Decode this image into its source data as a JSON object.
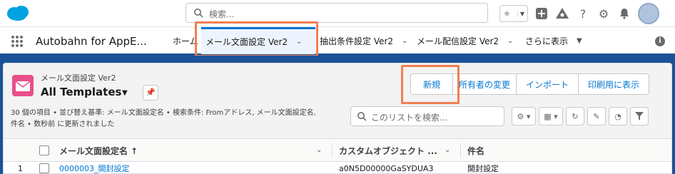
{
  "header": {
    "search_placeholder": "検索...",
    "icons": [
      "cloud-logo",
      "favorites-star-icon",
      "add-icon",
      "trailhead-icon",
      "help-icon",
      "setup-gear-icon",
      "notifications-bell-icon",
      "user-avatar"
    ]
  },
  "nav": {
    "app_name": "Autobahn for AppE...",
    "items": [
      {
        "label": "ホーム",
        "dropdown": false,
        "active": false
      },
      {
        "label": "メール文面設定 Ver2",
        "dropdown": true,
        "active": true
      },
      {
        "label": "抽出条件設定 Ver2",
        "dropdown": true,
        "active": false
      },
      {
        "label": "メール配信設定 Ver2",
        "dropdown": true,
        "active": false
      },
      {
        "label": "さらに表示",
        "dropdown": true,
        "active": false
      }
    ]
  },
  "list_view": {
    "object_label": "メール文面設定 Ver2",
    "title": "All Templates",
    "meta_line1": "30 個の項目 • 並び替え基準: メール文面設定名 • 検索条件: Fromアドレス, メール文面設定名,",
    "meta_line2": "件名 • 数秒前 に更新されました",
    "buttons": [
      "新規",
      "所有者の変更",
      "インポート",
      "印刷用に表示"
    ],
    "search_placeholder": "このリストを検索...",
    "columns": [
      {
        "label": "メール文面設定名 ↑"
      },
      {
        "label": "カスタムオブジェクト ..."
      },
      {
        "label": "件名"
      }
    ],
    "rows": [
      {
        "num": "1",
        "name": "0000003_開封設定",
        "object": "a0N5D00000GaSYDUA3",
        "subject": "開封設定"
      }
    ]
  },
  "colors": {
    "brand_blue": "#1b5297",
    "link_blue": "#0176d3",
    "highlight_orange": "#f27e52",
    "object_icon_pink": "#e84f8b"
  }
}
